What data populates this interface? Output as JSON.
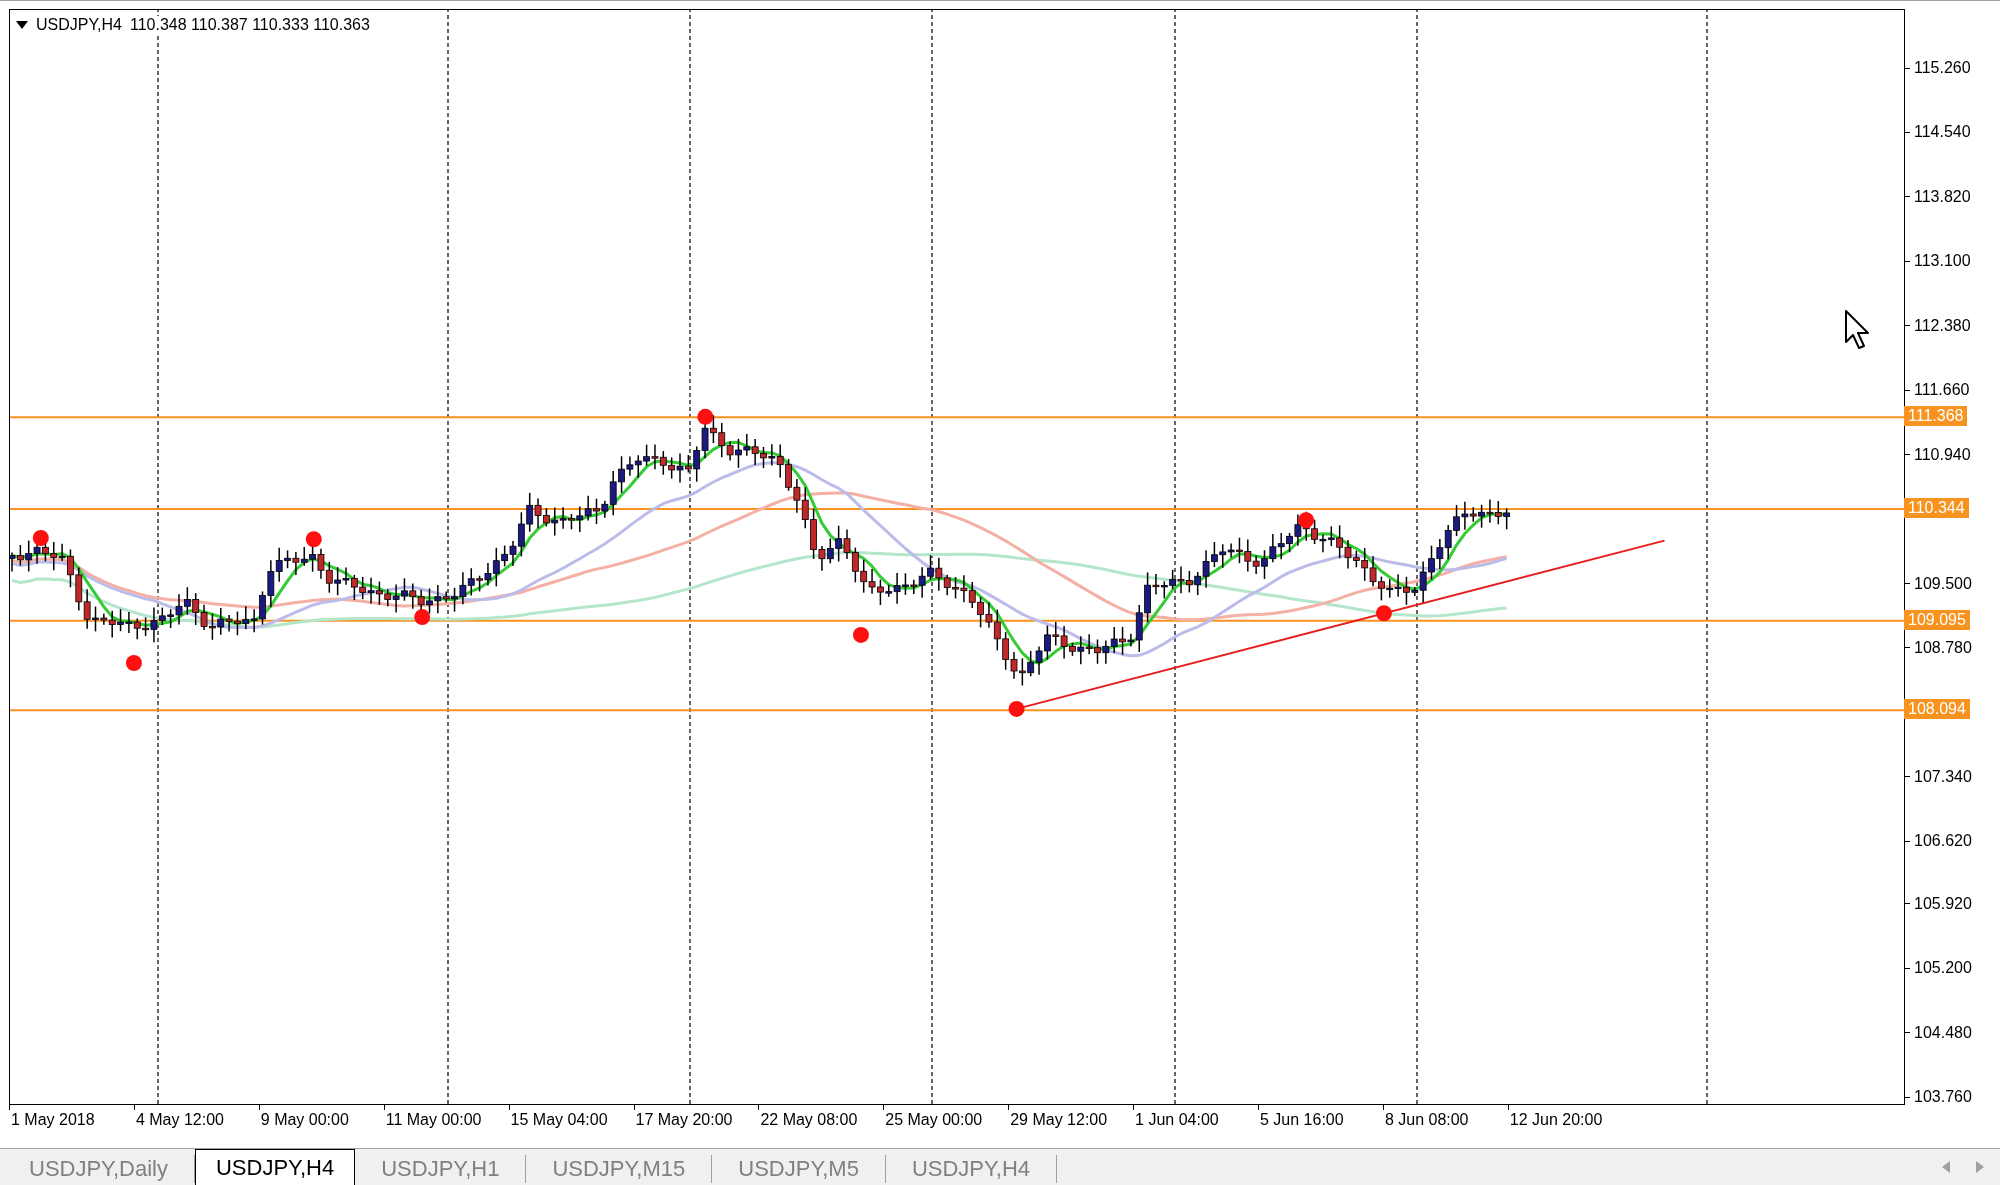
{
  "chart": {
    "symbol": "USDJPY,H4",
    "ohlc": "110.348 110.387 110.333 110.363",
    "price_axis": [
      "115.260",
      "114.540",
      "113.820",
      "113.100",
      "112.380",
      "111.660",
      "110.940",
      "109.500",
      "108.780",
      "107.340",
      "106.620",
      "105.920",
      "105.200",
      "104.480",
      "103.760"
    ],
    "price_lines": [
      {
        "label": "111.368"
      },
      {
        "label": "110.344"
      },
      {
        "label": "109.095"
      },
      {
        "label": "108.094"
      }
    ],
    "time_axis": [
      "1 May 2018",
      "4 May 12:00",
      "9 May 00:00",
      "11 May 00:00",
      "15 May 04:00",
      "17 May 20:00",
      "22 May 08:00",
      "25 May 00:00",
      "29 May 12:00",
      "1 Jun 04:00",
      "5 Jun 16:00",
      "8 Jun 08:00",
      "12 Jun 20:00"
    ]
  },
  "tabs": [
    {
      "label": "USDJPY,Daily",
      "selected": false
    },
    {
      "label": "USDJPY,H4",
      "selected": true
    },
    {
      "label": "USDJPY,H1",
      "selected": false
    },
    {
      "label": "USDJPY,M15",
      "selected": false
    },
    {
      "label": "USDJPY,M5",
      "selected": false
    },
    {
      "label": "USDJPY,H4",
      "selected": false
    }
  ]
}
